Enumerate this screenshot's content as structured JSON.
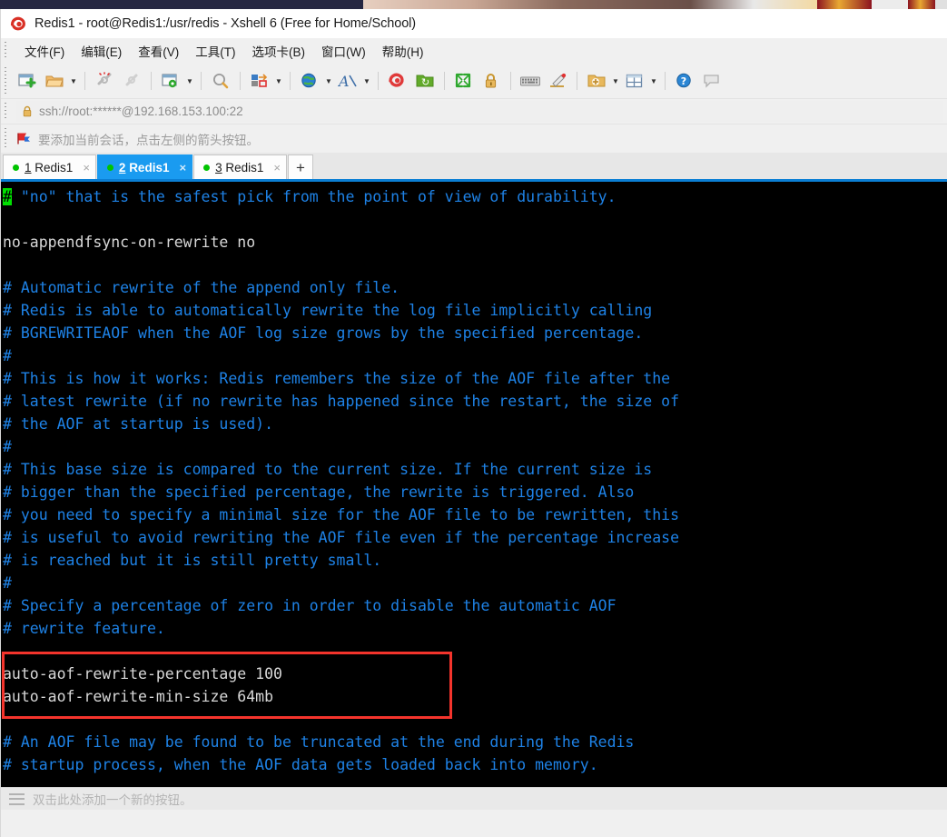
{
  "window": {
    "title": "Redis1 - root@Redis1:/usr/redis - Xshell 6 (Free for Home/School)",
    "app_icon": "xshell-logo-icon"
  },
  "menubar": {
    "items": [
      {
        "label": "文件(F)",
        "name": "menu-file"
      },
      {
        "label": "编辑(E)",
        "name": "menu-edit"
      },
      {
        "label": "查看(V)",
        "name": "menu-view"
      },
      {
        "label": "工具(T)",
        "name": "menu-tools"
      },
      {
        "label": "选项卡(B)",
        "name": "menu-tab"
      },
      {
        "label": "窗口(W)",
        "name": "menu-window"
      },
      {
        "label": "帮助(H)",
        "name": "menu-help"
      }
    ]
  },
  "toolbar": {
    "buttons": [
      "new-session-icon",
      "open-folder-icon",
      "disconnect-icon",
      "reconnect-icon",
      "session-properties-icon",
      "find-icon",
      "transfer-file-icon",
      "web-browser-icon",
      "font-icon",
      "nautilus-icon",
      "green-folder-icon",
      "fullscreen-icon",
      "lock-icon",
      "keyboard-icon",
      "compose-bar-icon",
      "add-to-folder-icon",
      "layout-icon",
      "help-icon",
      "chat-icon"
    ]
  },
  "addressbar": {
    "lock_icon": "lock-icon",
    "url": "ssh://root:******@192.168.153.100:22"
  },
  "notifybar": {
    "icon": "red-flag-icon",
    "message": "要添加当前会话，点击左侧的箭头按钮。"
  },
  "tabs": {
    "items": [
      {
        "num": "1",
        "label": "Redis1",
        "active": false,
        "status": "connected"
      },
      {
        "num": "2",
        "label": "Redis1",
        "active": true,
        "status": "connected"
      },
      {
        "num": "3",
        "label": "Redis1",
        "active": false,
        "status": "connected"
      }
    ],
    "add_label": "+",
    "close_label": "×"
  },
  "terminal": {
    "cursor_char": "#",
    "lines": [
      {
        "text": " \"no\" that is the safest pick from the point of view of durability.",
        "style": "comment",
        "cursor": true
      },
      {
        "text": "",
        "style": "comment"
      },
      {
        "text": "no-appendfsync-on-rewrite no",
        "style": "cmd"
      },
      {
        "text": "",
        "style": "comment"
      },
      {
        "text": "# Automatic rewrite of the append only file.",
        "style": "comment"
      },
      {
        "text": "# Redis is able to automatically rewrite the log file implicitly calling",
        "style": "comment"
      },
      {
        "text": "# BGREWRITEAOF when the AOF log size grows by the specified percentage.",
        "style": "comment"
      },
      {
        "text": "#",
        "style": "comment"
      },
      {
        "text": "# This is how it works: Redis remembers the size of the AOF file after the",
        "style": "comment"
      },
      {
        "text": "# latest rewrite (if no rewrite has happened since the restart, the size of",
        "style": "comment"
      },
      {
        "text": "# the AOF at startup is used).",
        "style": "comment"
      },
      {
        "text": "#",
        "style": "comment"
      },
      {
        "text": "# This base size is compared to the current size. If the current size is",
        "style": "comment"
      },
      {
        "text": "# bigger than the specified percentage, the rewrite is triggered. Also",
        "style": "comment"
      },
      {
        "text": "# you need to specify a minimal size for the AOF file to be rewritten, this",
        "style": "comment"
      },
      {
        "text": "# is useful to avoid rewriting the AOF file even if the percentage increase",
        "style": "comment"
      },
      {
        "text": "# is reached but it is still pretty small.",
        "style": "comment"
      },
      {
        "text": "#",
        "style": "comment"
      },
      {
        "text": "# Specify a percentage of zero in order to disable the automatic AOF",
        "style": "comment"
      },
      {
        "text": "# rewrite feature.",
        "style": "comment"
      },
      {
        "text": "",
        "style": "comment"
      },
      {
        "text": "auto-aof-rewrite-percentage 100",
        "style": "cmd"
      },
      {
        "text": "auto-aof-rewrite-min-size 64mb",
        "style": "cmd"
      },
      {
        "text": "",
        "style": "comment"
      },
      {
        "text": "# An AOF file may be found to be truncated at the end during the Redis",
        "style": "comment"
      },
      {
        "text": "# startup process, when the AOF data gets loaded back into memory.",
        "style": "comment"
      }
    ],
    "annotation": {
      "name": "red-highlight-box",
      "color": "#f4342c"
    }
  },
  "statusbar": {
    "icon": "hamburger-icon",
    "message": "双击此处添加一个新的按钮。"
  },
  "colors": {
    "accent_blue": "#0b7fd4",
    "tab_active": "#1a9bf0",
    "terminal_bg": "#000000",
    "comment_blue": "#1e82e6",
    "command_white": "#d8d8d8",
    "cursor_green": "#00e000",
    "annotation_red": "#f4342c",
    "status_dot_green": "#00c400"
  }
}
